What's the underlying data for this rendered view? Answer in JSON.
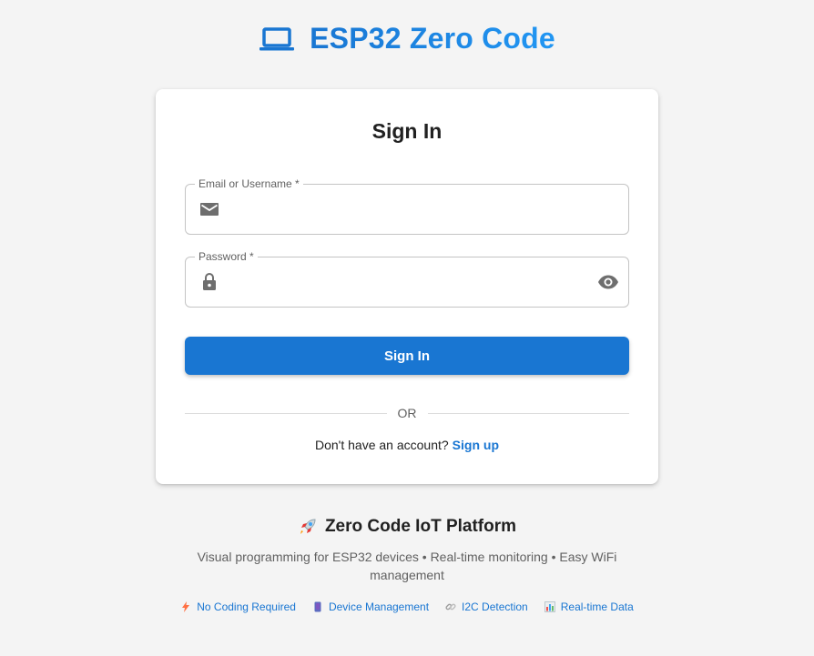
{
  "brand": {
    "title": "ESP32 Zero Code",
    "icon": "laptop-icon",
    "colors": {
      "start": "#1976d2",
      "end": "#2196f3"
    }
  },
  "login": {
    "title": "Sign In",
    "email_label": "Email or Username *",
    "email_value": "",
    "password_label": "Password *",
    "password_value": "",
    "submit_label": "Sign In",
    "divider": "OR",
    "signup_prompt": "Don't have an account?",
    "signup_link": "Sign up"
  },
  "platform": {
    "title": "Zero Code IoT Platform",
    "icon": "rocket-icon",
    "description": "Visual programming for ESP32 devices • Real-time monitoring • Easy WiFi management",
    "features": [
      {
        "icon": "lightning-icon",
        "label": "No Coding Required"
      },
      {
        "icon": "device-icon",
        "label": "Device Management"
      },
      {
        "icon": "link-icon",
        "label": "I2C Detection"
      },
      {
        "icon": "bar-chart-icon",
        "label": "Real-time Data"
      }
    ]
  },
  "colors": {
    "primary": "#1976d2",
    "background": "#f4f4f4",
    "card": "#ffffff"
  }
}
